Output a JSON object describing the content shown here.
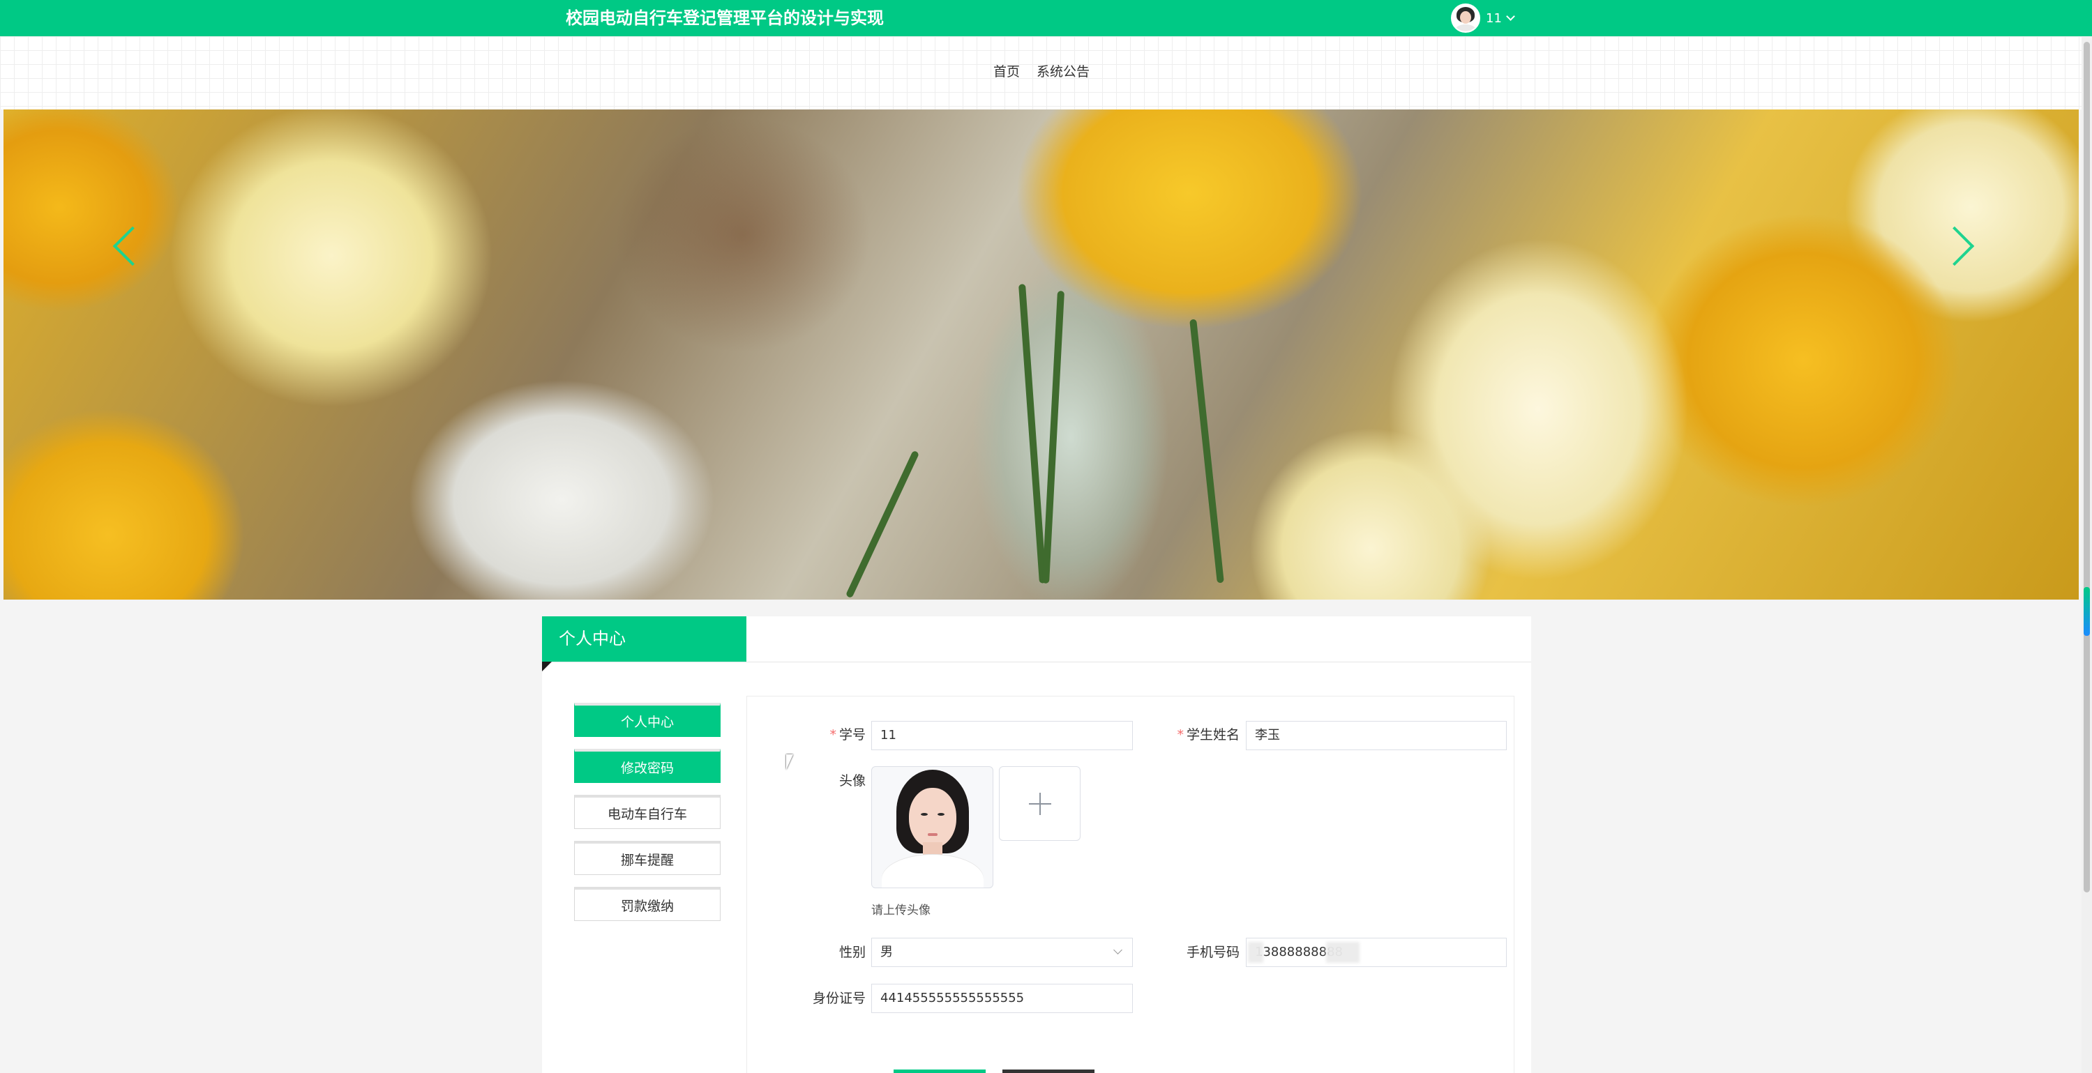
{
  "header": {
    "site_title": "校园电动自行车登记管理平台的设计与实现",
    "user_name": "11"
  },
  "nav": {
    "items": [
      "首页",
      "系统公告"
    ]
  },
  "banner": {
    "prev_icon": "chevron-left-icon",
    "next_icon": "chevron-right-icon"
  },
  "personal_center": {
    "tab_title": "个人中心",
    "menu": [
      {
        "label": "个人中心",
        "active": true
      },
      {
        "label": "修改密码",
        "active": true
      },
      {
        "label": "电动车自行车",
        "active": false
      },
      {
        "label": "挪车提醒",
        "active": false
      },
      {
        "label": "罚款缴纳",
        "active": false
      }
    ]
  },
  "form": {
    "student_id_label": "学号",
    "student_id_value": "11",
    "student_name_label": "学生姓名",
    "student_name_value": "李玉",
    "avatar_label": "头像",
    "avatar_tip": "请上传头像",
    "gender_label": "性别",
    "gender_value": "男",
    "phone_label": "手机号码",
    "phone_value": "13888888888",
    "id_card_label": "身份证号",
    "id_card_value": "441455555555555555"
  },
  "colors": {
    "primary": "#00c985",
    "required": "#f56c6c"
  }
}
